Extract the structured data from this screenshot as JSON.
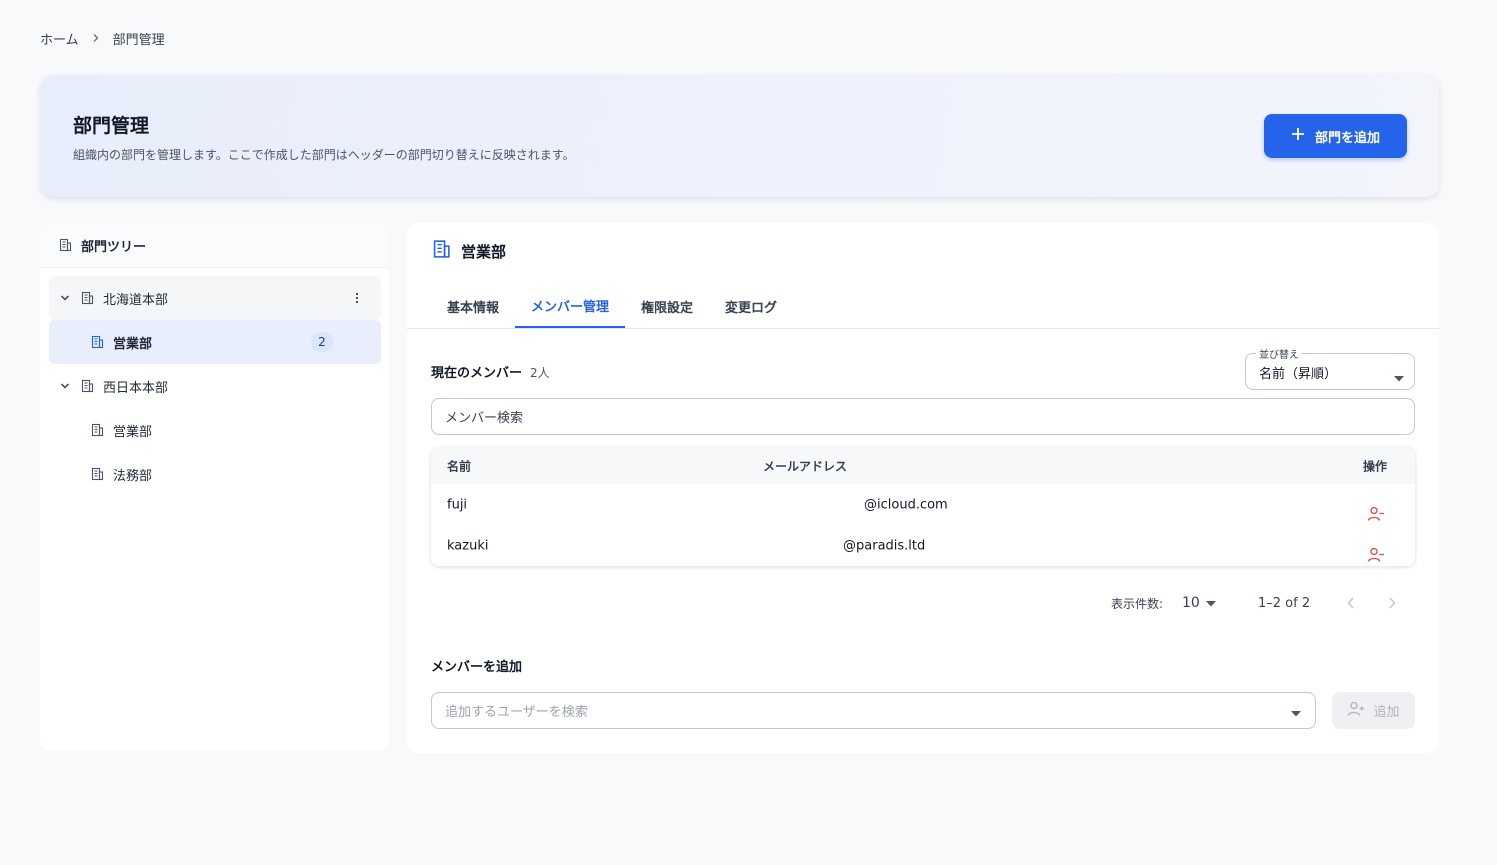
{
  "breadcrumb": {
    "home": "ホーム",
    "current": "部門管理"
  },
  "hero": {
    "title": "部門管理",
    "subtitle": "組織内の部門を管理します。ここで作成した部門はヘッダーの部門切り替えに反映されます。",
    "add_button": "部門を追加"
  },
  "tree": {
    "title": "部門ツリー",
    "items": [
      {
        "label": "北海道本部",
        "level": 0,
        "expanded": true
      },
      {
        "label": "営業部",
        "level": 1,
        "selected": true,
        "count": "2"
      },
      {
        "label": "西日本本部",
        "level": 0,
        "expanded": true
      },
      {
        "label": "営業部",
        "level": 1
      },
      {
        "label": "法務部",
        "level": 1
      }
    ]
  },
  "panel": {
    "title": "営業部",
    "tabs": [
      "基本情報",
      "メンバー管理",
      "権限設定",
      "変更ログ"
    ],
    "active_tab": "メンバー管理",
    "members_title": "現在のメンバー",
    "members_count": "2人",
    "sort_label": "並び替え",
    "sort_value": "名前（昇順）",
    "search_placeholder": "メンバー検索",
    "columns": {
      "name": "名前",
      "email": "メールアドレス",
      "actions": "操作"
    },
    "rows": [
      {
        "name": "fuji",
        "email": "@icloud.com"
      },
      {
        "name": "kazuki",
        "email": "@paradis.ltd"
      }
    ],
    "pager": {
      "rows_label": "表示件数:",
      "rows_value": "10",
      "range": "1–2 of 2"
    },
    "add_title": "メンバーを追加",
    "add_placeholder": "追加するユーザーを検索",
    "add_button": "追加"
  },
  "colors": {
    "accent": "#2563eb",
    "danger": "#dc4a4a",
    "badge_bg": "#dbe6f8",
    "selected_bg": "#e8eefb"
  },
  "icons": [
    "chevron-right-icon",
    "plus-icon",
    "building-icon",
    "chevron-down-icon",
    "more-vert-icon",
    "user-remove-icon",
    "user-add-icon",
    "arrow-drop-down-icon",
    "chevron-left-icon"
  ]
}
